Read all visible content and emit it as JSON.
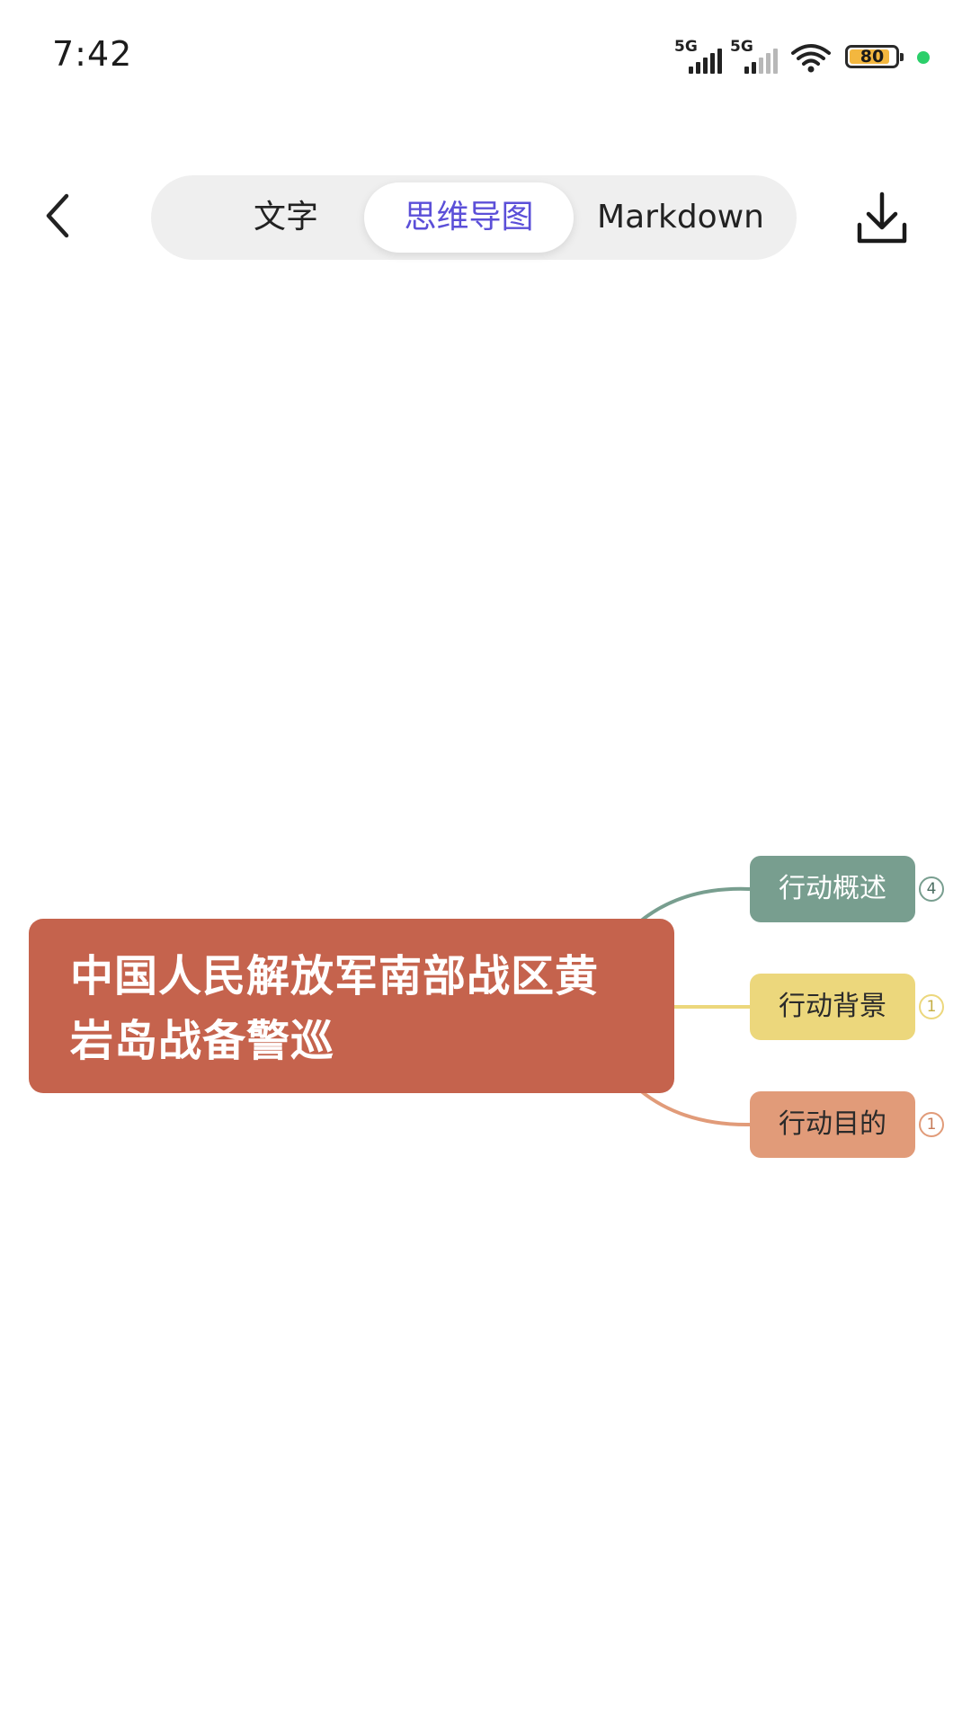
{
  "status_bar": {
    "time": "7:42",
    "signal1_label": "5G",
    "signal2_label": "5G",
    "battery_level": "80",
    "icons": [
      "signal-icon",
      "signal-icon",
      "wifi-icon",
      "battery-icon",
      "green-dot-indicator"
    ],
    "colors": {
      "battery_fill": "#f3b73f",
      "dot": "#2bcf6a"
    }
  },
  "header": {
    "back_icon": "chevron-left-icon",
    "tabs": [
      {
        "label": "文字",
        "active": false
      },
      {
        "label": "思维导图",
        "active": true
      },
      {
        "label": "Markdown",
        "active": false
      }
    ],
    "download_icon": "download-icon",
    "accent_color": "#5b4fd8"
  },
  "mindmap": {
    "root": {
      "line1": "中国人民解放军南部战区黄",
      "line2": "岩岛战备警巡",
      "color": "#c5634d"
    },
    "children": [
      {
        "label": "行动概述",
        "count": "4",
        "color": "#789e8f"
      },
      {
        "label": "行动背景",
        "count": "1",
        "color": "#ecd77c"
      },
      {
        "label": "行动目的",
        "count": "1",
        "color": "#e19b79"
      }
    ]
  }
}
